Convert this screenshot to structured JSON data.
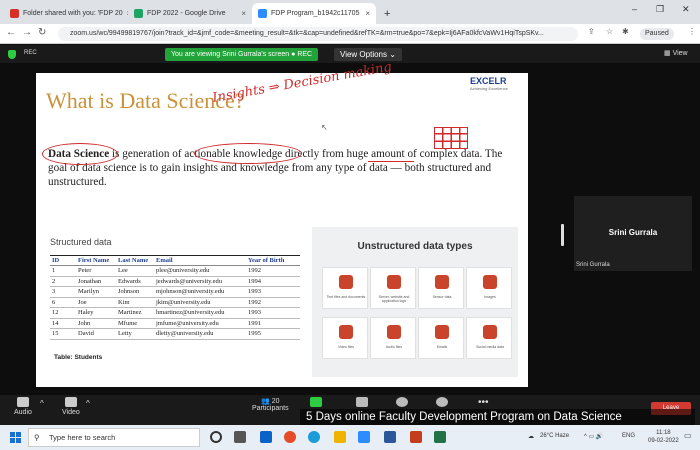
{
  "browser": {
    "tabs": [
      {
        "label": "Folder shared with you: 'FDP 20",
        "color": "#d93025"
      },
      {
        "label": "FDP 2022 - Google Drive",
        "color": "#1fa463"
      },
      {
        "label": "FDP Program_b1942c11705",
        "color": "#2d8cff"
      }
    ],
    "new_tab": "+",
    "url": "zoom.us/wc/99499819767/join?track_id=&jmf_code=&meeting_result=&tk=&cap=undefined&refTK=&rm=true&po=7&epk=Ij6AFa0kfcVaWv1HqiTspSKv...",
    "paused_label": "Paused"
  },
  "zoom": {
    "rec": "REC",
    "viewing_banner": "You are viewing Srini Gurrala's screen",
    "viewing_rec": "REC",
    "view_options": "View Options",
    "view_btn": "View",
    "participant": {
      "name": "Srini Gurrala",
      "label": "Srini Gurrala"
    },
    "toolbar": {
      "audio": "Audio",
      "video": "Video",
      "participants": "Participants",
      "participants_count": "20",
      "leave": "Leave"
    },
    "banner": "5 Days online Faculty Development Program on Data Science"
  },
  "slide": {
    "title": "What is Data Science?",
    "logo": "EXCELR",
    "logo_sub": "Achieving Excellence",
    "handwriting": "Insights ⇒ Decision making",
    "para_bold": "Data Science",
    "para_rest": " is generation of actionable knowledge directly from huge amount of complex data. The goal of data science is to gain insights and knowledge from any type of data — both structured and unstructured.",
    "structured_title": "Structured data",
    "table_caption": "Table: Students",
    "columns": [
      "ID",
      "First Name",
      "Last Name",
      "Email",
      "Year of Birth"
    ],
    "rows": [
      [
        "1",
        "Peter",
        "Lee",
        "plee@university.edu",
        "1992"
      ],
      [
        "2",
        "Jonathan",
        "Edwards",
        "jedwards@university.edu",
        "1994"
      ],
      [
        "3",
        "Marilyn",
        "Johnson",
        "mjohnson@university.edu",
        "1993"
      ],
      [
        "6",
        "Joe",
        "Kim",
        "jkim@university.edu",
        "1992"
      ],
      [
        "12",
        "Haley",
        "Martinez",
        "hmartinez@university.edu",
        "1993"
      ],
      [
        "14",
        "John",
        "Mfume",
        "jmfume@university.edu",
        "1991"
      ],
      [
        "15",
        "David",
        "Letty",
        "dletty@university.edu",
        "1995"
      ]
    ],
    "unstructured_title": "Unstructured data types",
    "unstructured": [
      {
        "label": "Text files and documents",
        "icon": "document-icon"
      },
      {
        "label": "Server, website and application logs",
        "icon": "server-icon"
      },
      {
        "label": "Sensor data",
        "icon": "sensor-icon"
      },
      {
        "label": "Images",
        "icon": "image-icon"
      },
      {
        "label": "Video files",
        "icon": "video-icon"
      },
      {
        "label": "Audio files",
        "icon": "audio-icon"
      },
      {
        "label": "Emails",
        "icon": "email-icon"
      },
      {
        "label": "Social media data",
        "icon": "social-icon"
      }
    ]
  },
  "taskbar": {
    "search_placeholder": "Type here to search",
    "weather": "26°C Haze",
    "lang": "ENG",
    "time": "11:18",
    "date": "09-02-2022"
  }
}
